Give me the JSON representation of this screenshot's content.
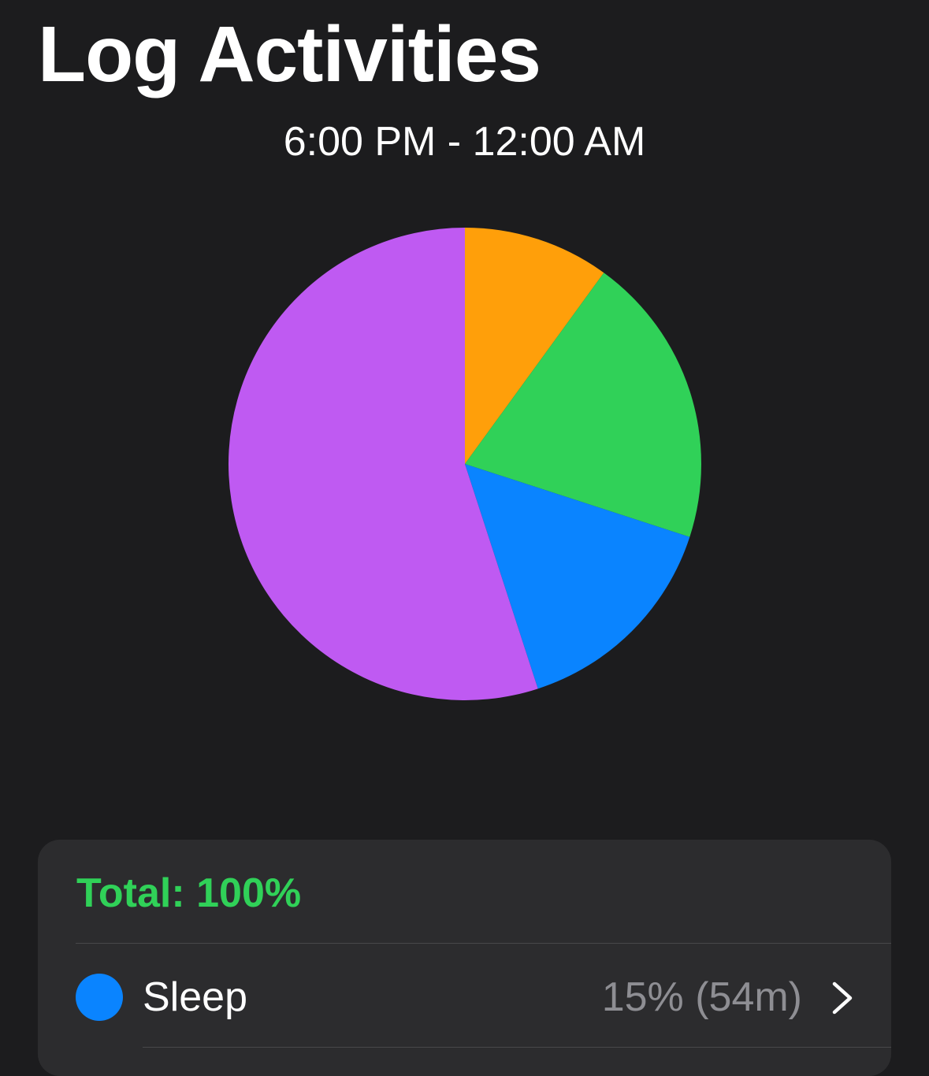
{
  "header": {
    "title": "Log Activities",
    "time_range": "6:00 PM - 12:00 AM"
  },
  "colors": {
    "background": "#1c1c1e",
    "card": "#2c2c2e",
    "orange": "#ff9f0a",
    "green": "#30d158",
    "blue": "#0a84ff",
    "purple": "#bf5af2",
    "secondary_text": "#8e8e93"
  },
  "chart_data": {
    "type": "pie",
    "slices": [
      {
        "value": 10,
        "color": "#ff9f0a"
      },
      {
        "value": 20,
        "color": "#30d158"
      },
      {
        "value": 15,
        "color": "#0a84ff"
      },
      {
        "value": 55,
        "color": "#bf5af2"
      }
    ]
  },
  "summary": {
    "total_label": "Total: 100%"
  },
  "activities": [
    {
      "label": "Sleep",
      "value": "15% (54m)",
      "color": "#0a84ff",
      "icon": "chevron-right-icon"
    }
  ]
}
